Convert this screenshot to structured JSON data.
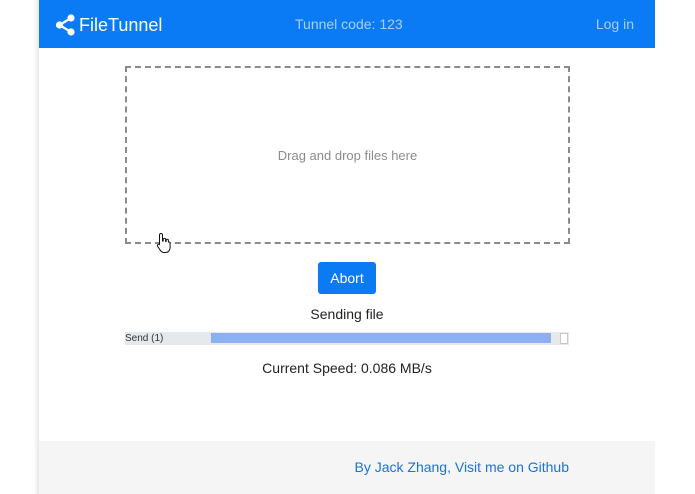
{
  "navbar": {
    "brand": "FileTunnel",
    "tunnel_code": "Tunnel code: 123",
    "login": "Log in",
    "colors": {
      "background": "#0b7bf5",
      "muted_text": "#a8cffb"
    }
  },
  "dropzone": {
    "placeholder": "Drag and drop files here"
  },
  "transfer": {
    "abort_label": "Abort",
    "status": "Sending file",
    "progress_label": "Send (1)",
    "progress_fraction": 0.975,
    "speed": "Current Speed: 0.086 MB/s",
    "colors": {
      "fill": "#8ab0ef",
      "track": "#e6e9ec"
    }
  },
  "footer": {
    "link": "By Jack Zhang, Visit me on Github"
  },
  "icons": {
    "brand": "share-icon",
    "cursor": "hand-pointer-icon"
  }
}
